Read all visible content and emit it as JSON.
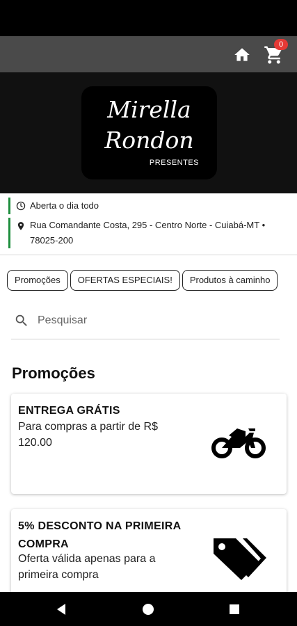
{
  "header": {
    "cart_count": "0",
    "icons": [
      "home-icon",
      "cart-icon"
    ]
  },
  "brand": {
    "name_line1": "Mirella",
    "name_line2": "Rondon",
    "tagline": "PRESENTES"
  },
  "store_info": {
    "hours": "Aberta o dia todo",
    "address": "Rua Comandante Costa, 295 - Centro Norte - Cuiabá-MT • 78025-200"
  },
  "categories": [
    {
      "label": "Promoções"
    },
    {
      "label": "OFERTAS ESPECIAIS!"
    },
    {
      "label": "Produtos à caminho"
    }
  ],
  "search": {
    "placeholder": "Pesquisar"
  },
  "promotions": {
    "title": "Promoções",
    "items": [
      {
        "title": "ENTREGA GRÁTIS",
        "description": "Para compras a partir de R$ 120.00",
        "icon": "motorcycle-icon"
      },
      {
        "title": "5% DESCONTO NA PRIMEIRA COMPRA",
        "description": "Oferta válida apenas para a primeira compra",
        "icon": "tags-icon"
      }
    ]
  },
  "colors": {
    "app_bar": "#4a4a4a",
    "hero": "#111111",
    "badge": "#e53935",
    "info_accent": "#1e8e3e"
  }
}
